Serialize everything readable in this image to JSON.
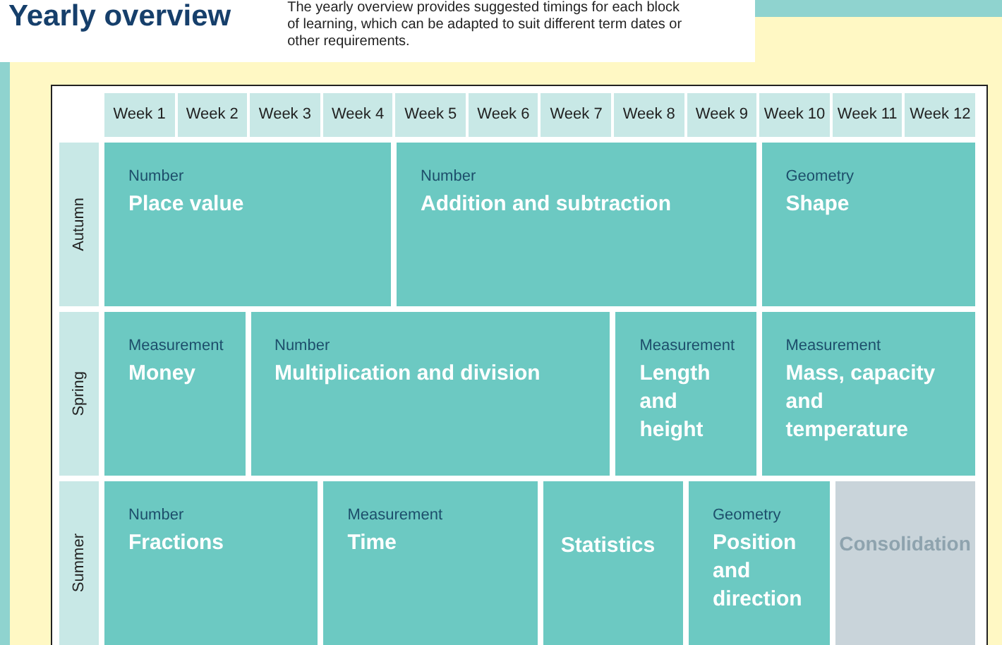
{
  "header": {
    "title": "Yearly overview",
    "intro": "The yearly overview provides suggested timings for each block of learning, which can be adapted to suit different term dates or other requirements."
  },
  "weeks": [
    "Week 1",
    "Week 2",
    "Week 3",
    "Week 4",
    "Week 5",
    "Week 6",
    "Week 7",
    "Week 8",
    "Week 9",
    "Week 10",
    "Week 11",
    "Week 12"
  ],
  "terms": [
    {
      "name": "Autumn",
      "blocks": [
        {
          "kind": "block",
          "category": "Number",
          "title": "Place value"
        },
        {
          "kind": "block",
          "category": "Number",
          "title": "Addition and subtraction"
        },
        {
          "kind": "block",
          "category": "Geometry",
          "title": "Shape"
        }
      ]
    },
    {
      "name": "Spring",
      "blocks": [
        {
          "kind": "block",
          "category": "Measurement",
          "title": "Money"
        },
        {
          "kind": "block",
          "category": "Number",
          "title": "Multiplication and division"
        },
        {
          "kind": "block",
          "category": "Measurement",
          "title": "Length and height"
        },
        {
          "kind": "block",
          "category": "Measurement",
          "title": "Mass, capacity and temperature"
        }
      ]
    },
    {
      "name": "Summer",
      "blocks": [
        {
          "kind": "block",
          "category": "Number",
          "title": "Fractions"
        },
        {
          "kind": "block",
          "category": "Measurement",
          "title": "Time"
        },
        {
          "kind": "block",
          "title": "Statistics"
        },
        {
          "kind": "block",
          "category": "Geometry",
          "title": "Position and direction"
        },
        {
          "kind": "consolidation",
          "title": "Consolidation"
        }
      ]
    }
  ]
}
